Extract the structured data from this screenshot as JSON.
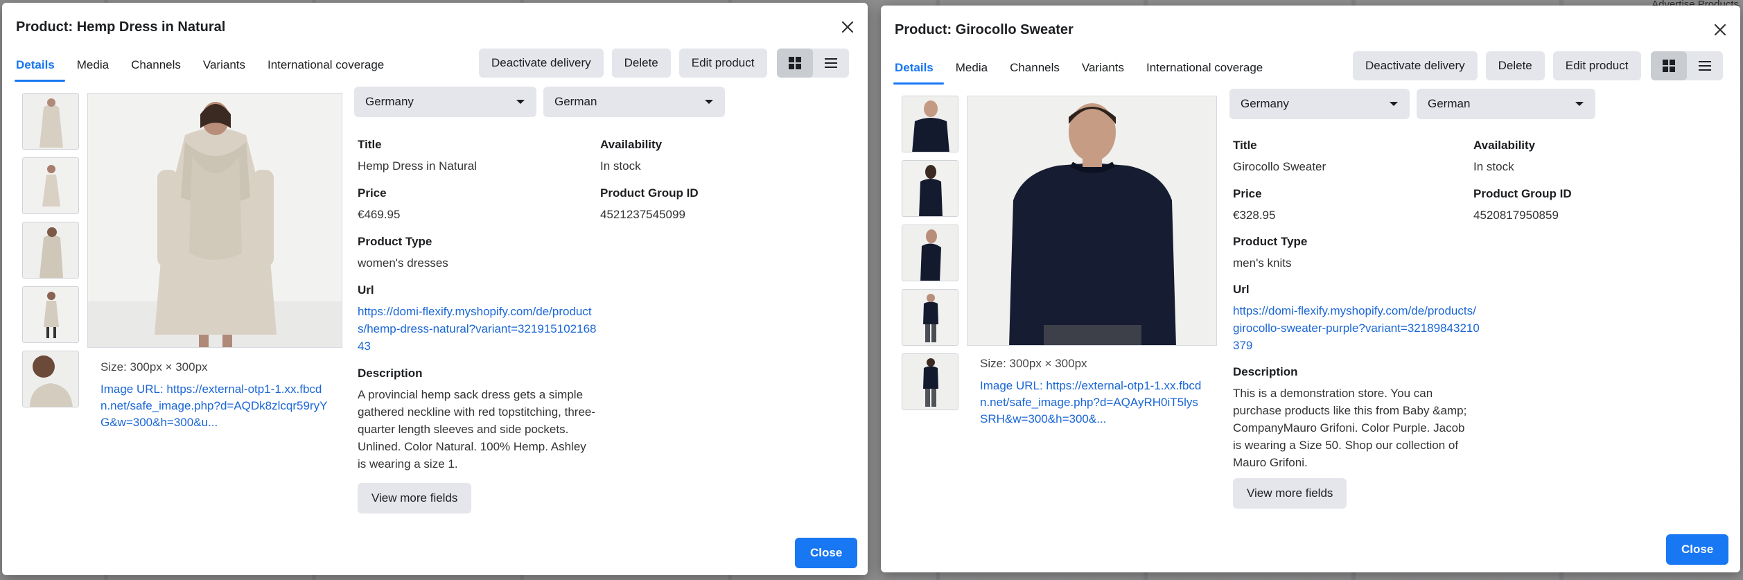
{
  "background": {
    "top_right_text": "Advertise Products"
  },
  "common": {
    "tabs": [
      "Details",
      "Media",
      "Channels",
      "Variants",
      "International coverage"
    ],
    "deactivate_label": "Deactivate delivery",
    "delete_label": "Delete",
    "edit_label": "Edit product",
    "country": "Germany",
    "language": "German",
    "labels": {
      "title": "Title",
      "availability": "Availability",
      "price": "Price",
      "group_id": "Product Group ID",
      "type": "Product Type",
      "url": "Url",
      "description": "Description"
    },
    "view_more_label": "View more fields",
    "close_label": "Close",
    "accent_color": "#1877f2"
  },
  "product1": {
    "header": "Product: Hemp Dress in Natural",
    "size": "Size: 300px × 300px",
    "image_url": "Image URL: https://external-otp1-1.xx.fbcdn.net/safe_image.php?d=AQDk8zlcqr59ryYG&w=300&h=300&u...",
    "title": "Hemp Dress in Natural",
    "availability": "In stock",
    "price": "€469.95",
    "group_id": "4521237545099",
    "type": "women's dresses",
    "url": "https://domi-flexify.myshopify.com/de/products/hemp-dress-natural?variant=32191510216843",
    "description": "A provincial hemp sack dress gets a simple gathered neckline with red topstitching, three-quarter length sleeves and side pockets. Unlined. Color Natural. 100% Hemp. Ashley is wearing a size 1."
  },
  "product2": {
    "header": "Product: Girocollo Sweater",
    "size": "Size: 300px × 300px",
    "image_url": "Image URL: https://external-otp1-1.xx.fbcdn.net/safe_image.php?d=AQAyRH0iT5lysSRH&w=300&h=300&...",
    "title": "Girocollo Sweater",
    "availability": "In stock",
    "price": "€328.95",
    "group_id": "4520817950859",
    "type": "men's knits",
    "url": "https://domi-flexify.myshopify.com/de/products/girocollo-sweater-purple?variant=32189843210379",
    "description": "This is a demonstration store. You can purchase products like this from Baby &amp; CompanyMauro Grifoni. Color Purple. Jacob is wearing a Size 50. Shop our collection of Mauro Grifoni."
  }
}
